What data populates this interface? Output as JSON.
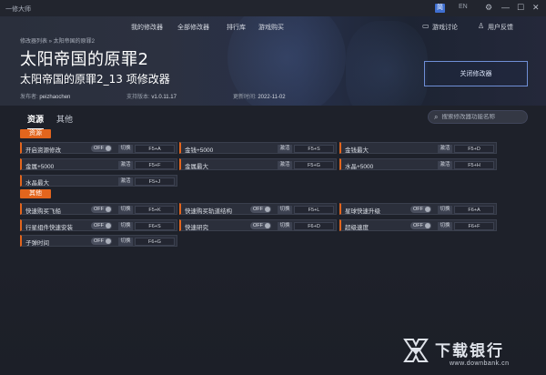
{
  "window": {
    "app_name": "一修大师",
    "lang_cn": "简",
    "lang_en": "EN",
    "settings_icon": "gear-icon",
    "minimize_icon": "minimize-icon",
    "maximize_icon": "maximize-icon",
    "close_icon": "close-icon"
  },
  "nav": {
    "items": [
      "我的修改器",
      "全部修改器",
      "排行库",
      "游戏购买"
    ],
    "discuss": "游戏讨论",
    "feedback": "用户反馈"
  },
  "breadcrumb": "修改器列表 » 太阳帝国的原罪2",
  "game": {
    "title": "太阳帝国的原罪2",
    "subtitle": "太阳帝国的原罪2_13 项修改器",
    "publisher_label": "发布者:",
    "publisher": "peizhaochen",
    "version_label": "支持版本:",
    "version": "v1.0.11.17",
    "updated_label": "更新时间:",
    "updated": "2022-11-02",
    "close_button": "关闭修改器"
  },
  "tabs": [
    "资源",
    "其他"
  ],
  "search": {
    "placeholder": "搜索修改器功能名称"
  },
  "sections": [
    {
      "name": "资源",
      "rows": [
        [
          {
            "label": "开启资源修改",
            "type": "toggle",
            "state": "OFF",
            "action": "切换",
            "hotkey": "F5+A"
          },
          {
            "label": "金钱+5000",
            "type": "button",
            "action": "激活",
            "hotkey": "F5+S"
          },
          {
            "label": "金钱最大",
            "type": "button",
            "action": "激活",
            "hotkey": "F5+D"
          }
        ],
        [
          {
            "label": "金属+5000",
            "type": "button",
            "action": "激活",
            "hotkey": "F5+F"
          },
          {
            "label": "金属最大",
            "type": "button",
            "action": "激活",
            "hotkey": "F5+G"
          },
          {
            "label": "水晶+5000",
            "type": "button",
            "action": "激活",
            "hotkey": "F5+H"
          }
        ],
        [
          {
            "label": "水晶最大",
            "type": "button",
            "action": "激活",
            "hotkey": "F5+J"
          }
        ]
      ]
    },
    {
      "name": "其他",
      "rows": [
        [
          {
            "label": "快速购买飞船",
            "type": "toggle",
            "state": "OFF",
            "action": "切换",
            "hotkey": "F5+K"
          },
          {
            "label": "快速购买轨道结构",
            "type": "toggle",
            "state": "OFF",
            "action": "切换",
            "hotkey": "F5+L"
          },
          {
            "label": "星球快速升级",
            "type": "toggle",
            "state": "OFF",
            "action": "切换",
            "hotkey": "F6+A"
          }
        ],
        [
          {
            "label": "行星组件快速安装",
            "type": "toggle",
            "state": "OFF",
            "action": "切换",
            "hotkey": "F6+S"
          },
          {
            "label": "快速研究",
            "type": "toggle",
            "state": "OFF",
            "action": "切换",
            "hotkey": "F6+D"
          },
          {
            "label": "超级速度",
            "type": "toggle",
            "state": "OFF",
            "action": "切换",
            "hotkey": "F6+F"
          }
        ],
        [
          {
            "label": "子弹时间",
            "type": "toggle",
            "state": "OFF",
            "action": "切换",
            "hotkey": "F6+G"
          }
        ]
      ]
    }
  ],
  "watermark": {
    "text": "下载银行",
    "url": "www.downbank.cn"
  }
}
